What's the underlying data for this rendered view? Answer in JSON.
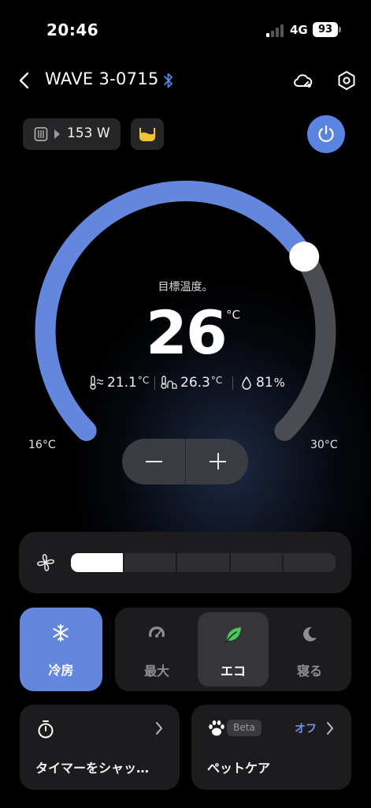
{
  "status_bar": {
    "time": "20:46",
    "network": "4G",
    "battery": "93",
    "signal_bars_active": 1
  },
  "header": {
    "title": "WAVE 3-0715",
    "icons": [
      "back-chevron-icon",
      "bluetooth-icon",
      "cloud-sync-icon",
      "settings-icon"
    ]
  },
  "power_chip": {
    "value": "153 W"
  },
  "dial": {
    "label": "目標温度。",
    "target": "26",
    "unit": "°C",
    "min_label": "16°C",
    "max_label": "30°C",
    "range": [
      16,
      30
    ],
    "setpoint": 26,
    "readings": [
      {
        "icon": "ambient-temperature-icon",
        "value": "21.1",
        "unit": "°C"
      },
      {
        "icon": "outlet-temperature-icon",
        "value": "26.3",
        "unit": "°C"
      },
      {
        "icon": "humidity-icon",
        "value": "81",
        "unit": "%"
      }
    ]
  },
  "fan": {
    "levels": 5,
    "level": 1
  },
  "modes": {
    "cool": {
      "label": "冷房"
    },
    "options": [
      {
        "label": "最大",
        "icon": "speedometer-icon",
        "selected": false
      },
      {
        "label": "エコ",
        "icon": "leaf-icon",
        "selected": true
      },
      {
        "label": "寝る",
        "icon": "moon-icon",
        "selected": false
      }
    ]
  },
  "timer_card": {
    "title": "タイマーをシャッ…"
  },
  "pet_card": {
    "title": "ペットケア",
    "badge": "Beta",
    "status": "オフ"
  },
  "colors": {
    "accent": "#6387dc",
    "leaf": "#49c95b",
    "track": "#4a4c52",
    "background": "#000000"
  }
}
